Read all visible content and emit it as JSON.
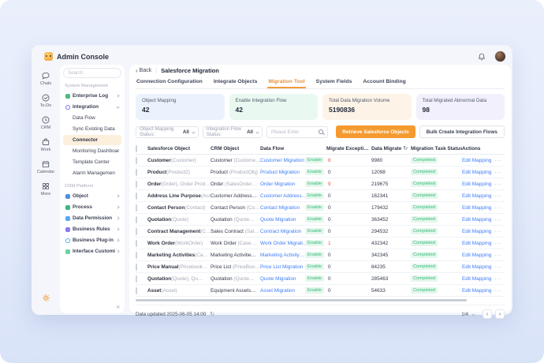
{
  "app": {
    "title": "Admin Console"
  },
  "rail": {
    "items": [
      {
        "id": "chats",
        "label": "Chats"
      },
      {
        "id": "todo",
        "label": "To-Do"
      },
      {
        "id": "crm",
        "label": "CRM"
      },
      {
        "id": "work",
        "label": "Work"
      },
      {
        "id": "calendar",
        "label": "Calendar"
      },
      {
        "id": "more",
        "label": "More"
      }
    ]
  },
  "sidebar": {
    "search_placeholder": "Search",
    "collapse_glyph": "«",
    "sections": [
      {
        "label": "System Management",
        "items": [
          {
            "label": "Enterprise Log",
            "icon": "enterprise-log-icon",
            "color": "#4fb97e",
            "chevron": "right"
          },
          {
            "label": "Integration",
            "icon": "integration-icon",
            "color": "#7a6ff0",
            "ring": true,
            "chevron": "down",
            "children": [
              "Data Flow",
              "Sync Existing Data",
              "Connector",
              "Monitoring Dashboard",
              "Template Center",
              "Alarm Managemen"
            ]
          }
        ]
      },
      {
        "label": "CRM Platform",
        "items": [
          {
            "label": "Object",
            "icon": "object-icon",
            "color": "#4a90e2",
            "chevron": "right"
          },
          {
            "label": "Process",
            "icon": "process-icon",
            "color": "#3cb87f",
            "chevron": "right"
          },
          {
            "label": "Data Permission",
            "icon": "data-permission-icon",
            "color": "#58a6f5",
            "chevron": "right"
          },
          {
            "label": "Business Rules",
            "icon": "business-rules-icon",
            "color": "#8a7af0",
            "chevron": "right"
          },
          {
            "label": "Business Plug-in",
            "icon": "business-plugin-icon",
            "color": "#49b4e8",
            "ring": true,
            "chevron": "right"
          },
          {
            "label": "Interface Customization",
            "icon": "interface-custom-icon",
            "color": "#6fd0a0",
            "chevron": "right"
          }
        ]
      }
    ],
    "active_item": "Connector"
  },
  "main": {
    "breadcrumb": {
      "back_glyph": "‹",
      "back": "Back",
      "divider": "|",
      "title": "Salesforce Migration"
    },
    "tabs": [
      "Connection Configuration",
      "Integrate Objects",
      "Migration Tool",
      "System Fields",
      "Account Binding"
    ],
    "active_tab": "Migration Tool",
    "stats": [
      {
        "label": "Object Mapping",
        "value": "42",
        "bg": "#eaf3fd"
      },
      {
        "label": "Enable Integration Flow",
        "value": "42",
        "bg": "#e9f9f1"
      },
      {
        "label": "Total Data Migration Volume",
        "value": "5190836",
        "bg": "#fdf4e7"
      },
      {
        "label": "Total Migrated Abnormal Data",
        "value": "98",
        "bg": "#f2f0fc"
      }
    ],
    "filters": {
      "select1_prefix": "Object Mapping Status:",
      "select1_value": "All",
      "select2_prefix": "Integration Flow Status:",
      "select2_value": "All",
      "search_placeholder": "Please Enter",
      "primary_button": "Retrieve Salesforce Objects",
      "secondary_button": "Bulk Create Integration Flows"
    },
    "table": {
      "columns": [
        "Salesforce Object",
        "CRM Object",
        "Data Flow",
        "Migrate Excepti…",
        "Data Migrate",
        "Migration Task Status",
        "Actions"
      ],
      "refresh_glyph": "↻",
      "enable_label": "Enable",
      "action_label": "Edit Mapping",
      "more_glyph": "···",
      "rows": [
        {
          "sf": "Customer",
          "sf_sub": "(Customer)",
          "crm": "Customer",
          "crm_sub": "(Custome…",
          "flow": "Customer Migration",
          "exceptions": "8",
          "alert": true,
          "migrated": "9980",
          "status": "Completed"
        },
        {
          "sf": "Product",
          "sf_sub": "(Product2)",
          "crm": "Product",
          "crm_sub": "(ProductObj)",
          "flow": "Product Migration",
          "exceptions": "0",
          "alert": false,
          "migrated": "12098",
          "status": "Completed"
        },
        {
          "sf": "Order",
          "sf_sub": "(Order), Order Prod…",
          "crm": "Order",
          "crm_sub": "(SalesOrder…",
          "flow": "Order Migration",
          "exceptions": "9",
          "alert": true,
          "migrated": "219675",
          "status": "Completed"
        },
        {
          "sf": "Address Line Purpose",
          "sf_sub": "(Acc…",
          "crm": "Customer Address…",
          "crm_sub": "",
          "flow": "Customer Address…",
          "exceptions": "0",
          "alert": false,
          "migrated": "162341",
          "status": "Completed"
        },
        {
          "sf": "Contact Person",
          "sf_sub": "(Contact)",
          "crm": "Contact Person",
          "crm_sub": "(Co…",
          "flow": "Contact Migration",
          "exceptions": "0",
          "alert": false,
          "migrated": "179432",
          "status": "Completed"
        },
        {
          "sf": "Quotation",
          "sf_sub": "(Quote)",
          "crm": "Quotation",
          "crm_sub": "(Quote…",
          "flow": "Quote Migration",
          "exceptions": "0",
          "alert": false,
          "migrated": "363452",
          "status": "Completed"
        },
        {
          "sf": "Contract Management",
          "sf_sub": "(C…",
          "crm": "Sales Contract",
          "crm_sub": "(Sal…",
          "flow": "Contract Migration",
          "exceptions": "0",
          "alert": false,
          "migrated": "294532",
          "status": "Completed"
        },
        {
          "sf": "Work Order",
          "sf_sub": "(WorkOrder)",
          "crm": "Work Order",
          "crm_sub": "(Case…",
          "flow": "Work Order Migrati…",
          "exceptions": "1",
          "alert": true,
          "migrated": "432342",
          "status": "Completed"
        },
        {
          "sf": "Marketing Activities",
          "sf_sub": "(Ca…",
          "crm": "Marketing Activitie…",
          "crm_sub": "",
          "flow": "Marketing Activity…",
          "exceptions": "0",
          "alert": false,
          "migrated": "342345",
          "status": "Completed"
        },
        {
          "sf": "Price Manual",
          "sf_sub": "(Pricebook…",
          "crm": "Price List",
          "crm_sub": "(PriceBoo…",
          "flow": "Price List Migration",
          "exceptions": "0",
          "alert": false,
          "migrated": "84235",
          "status": "Completed"
        },
        {
          "sf": "Quotation",
          "sf_sub": "(Quote), Qu…",
          "crm": "Quotation",
          "crm_sub": "(Quote…",
          "flow": "Quote Migration",
          "exceptions": "0",
          "alert": false,
          "migrated": "285463",
          "status": "Completed"
        },
        {
          "sf": "Asset",
          "sf_sub": "(Asset)",
          "crm": "Equipment Assets…",
          "crm_sub": "",
          "flow": "Asset Migration",
          "exceptions": "0",
          "alert": false,
          "migrated": "54633",
          "status": "Completed"
        }
      ]
    },
    "footer": {
      "updated": "Data updated 2025-06-05 14:00",
      "refresh_glyph": "↻",
      "page": "1/4",
      "prev_glyph": "‹",
      "next_glyph": "›"
    }
  },
  "colors": {
    "accent_orange": "#f59a2e",
    "link_blue": "#3e7cf7",
    "success_green": "#35b878",
    "alert_red": "#f2543d"
  }
}
